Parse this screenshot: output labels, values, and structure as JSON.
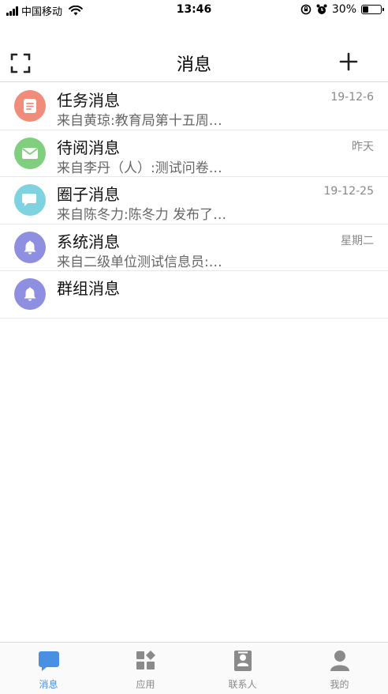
{
  "status_bar": {
    "carrier": "中国移动",
    "time": "13:46",
    "battery": "30%",
    "battery_level": 0.3
  },
  "nav": {
    "title": "消息"
  },
  "messages": [
    {
      "title": "任务消息",
      "subtitle": "来自黄琼:教育局第十五周…",
      "time": "19-12-6",
      "icon": "document-icon",
      "color": "#f08c7a"
    },
    {
      "title": "待阅消息",
      "subtitle": "来自李丹（人）:测试问卷…",
      "time": "昨天",
      "icon": "mail-icon",
      "color": "#7fcf7f"
    },
    {
      "title": "圈子消息",
      "subtitle": "来自陈冬力:陈冬力 发布了…",
      "time": "19-12-25",
      "icon": "chat-icon",
      "color": "#7fd3e0"
    },
    {
      "title": "系统消息",
      "subtitle": "来自二级单位测试信息员:…",
      "time": "星期二",
      "icon": "bell-icon",
      "color": "#8e8fe0"
    },
    {
      "title": "群组消息",
      "subtitle": "",
      "time": "",
      "icon": "bell-icon",
      "color": "#8e8fe0"
    }
  ],
  "tabs": [
    {
      "label": "消息",
      "icon": "message-icon",
      "active": true
    },
    {
      "label": "应用",
      "icon": "apps-icon",
      "active": false
    },
    {
      "label": "联系人",
      "icon": "contacts-icon",
      "active": false
    },
    {
      "label": "我的",
      "icon": "person-icon",
      "active": false
    }
  ],
  "colors": {
    "accent": "#4a90e2",
    "tab_inactive": "#888888"
  }
}
